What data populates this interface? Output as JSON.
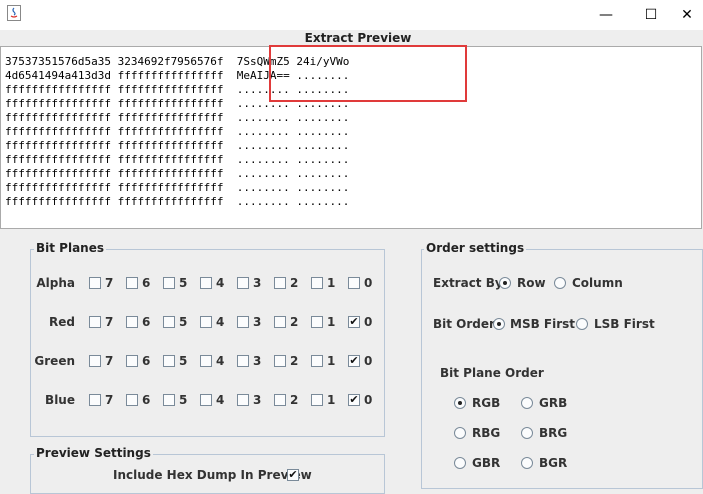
{
  "window": {
    "min_symbol": "—",
    "max_symbol": "☐",
    "close_symbol": "✕"
  },
  "preview": {
    "title": "Extract Preview",
    "lines": [
      "37537351576d5a35 3234692f7956576f  7SsQWmZ5 24i/yVWo",
      "4d6541494a413d3d ffffffffffffffff  MeAIJA== ........",
      "ffffffffffffffff ffffffffffffffff  ........ ........",
      "ffffffffffffffff ffffffffffffffff  ........ ........",
      "ffffffffffffffff ffffffffffffffff  ........ ........",
      "ffffffffffffffff ffffffffffffffff  ........ ........",
      "ffffffffffffffff ffffffffffffffff  ........ ........",
      "ffffffffffffffff ffffffffffffffff  ........ ........",
      "ffffffffffffffff ffffffffffffffff  ........ ........",
      "ffffffffffffffff ffffffffffffffff  ........ ........",
      "ffffffffffffffff ffffffffffffffff  ........ ........"
    ]
  },
  "bit_planes": {
    "title": "Bit Planes",
    "bits": [
      "7",
      "6",
      "5",
      "4",
      "3",
      "2",
      "1",
      "0"
    ],
    "rows": [
      {
        "label": "Alpha",
        "checked": [
          false,
          false,
          false,
          false,
          false,
          false,
          false,
          false
        ]
      },
      {
        "label": "Red",
        "checked": [
          false,
          false,
          false,
          false,
          false,
          false,
          false,
          true
        ]
      },
      {
        "label": "Green",
        "checked": [
          false,
          false,
          false,
          false,
          false,
          false,
          false,
          true
        ]
      },
      {
        "label": "Blue",
        "checked": [
          false,
          false,
          false,
          false,
          false,
          false,
          false,
          true
        ]
      }
    ]
  },
  "order_settings": {
    "title": "Order settings",
    "extract_by": {
      "label": "Extract By",
      "options": [
        "Row",
        "Column"
      ],
      "selected": "Row"
    },
    "bit_order": {
      "label": "Bit Order",
      "options": [
        "MSB First",
        "LSB First"
      ],
      "selected": "MSB First"
    },
    "bit_plane_order": {
      "label": "Bit Plane Order",
      "options": [
        "RGB",
        "GRB",
        "RBG",
        "BRG",
        "GBR",
        "BGR"
      ],
      "selected": "RGB"
    }
  },
  "preview_settings": {
    "title": "Preview Settings",
    "hex_dump": {
      "label": "Include Hex Dump In Preview",
      "checked": true
    }
  },
  "check_mark": "✔"
}
